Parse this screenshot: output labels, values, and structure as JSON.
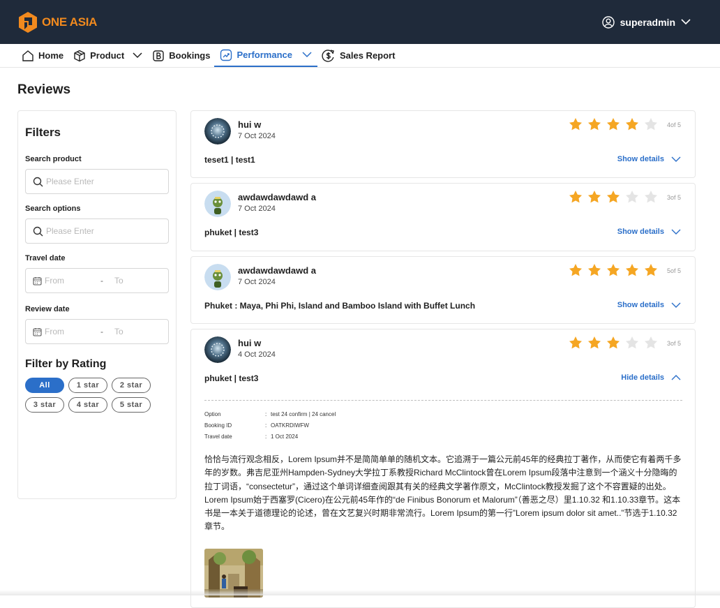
{
  "brand": {
    "name": "ONE ASIA",
    "accent": "#f28a1e",
    "header_bg": "#1f2a3a"
  },
  "user": {
    "name": "superadmin",
    "icon": "user-circle-icon"
  },
  "nav": {
    "home": "Home",
    "product": "Product",
    "bookings": "Bookings",
    "performance": "Performance",
    "sales_report": "Sales Report"
  },
  "page": {
    "title": "Reviews"
  },
  "filters": {
    "heading": "Filters",
    "search_product_label": "Search product",
    "search_product_placeholder": "Please Enter",
    "search_options_label": "Search options",
    "search_options_placeholder": "Please Enter",
    "travel_date_label": "Travel date",
    "review_date_label": "Review date",
    "from": "From",
    "to": "To",
    "dash": "-",
    "rating_heading": "Filter by Rating",
    "chips": [
      "All",
      "1 star",
      "2 star",
      "3 star",
      "4 star",
      "5 star"
    ],
    "active_chip": "All"
  },
  "reviews": [
    {
      "name": "hui  w",
      "date": "7 Oct 2024",
      "rating": 4,
      "score": "4of 5",
      "title": "teset1 | test1",
      "toggle": "Show details",
      "expanded": false
    },
    {
      "name": "awdawdawdawd  a",
      "date": "7 Oct 2024",
      "rating": 3,
      "score": "3of 5",
      "title": "phuket | test3",
      "toggle": "Show details",
      "expanded": false
    },
    {
      "name": "awdawdawdawd  a",
      "date": "7 Oct 2024",
      "rating": 5,
      "score": "5of 5",
      "title": "Phuket : Maya, Phi Phi, Island and Bamboo Island with Buffet Lunch",
      "toggle": "Show details",
      "expanded": false
    },
    {
      "name": "hui  w",
      "date": "4 Oct 2024",
      "rating": 3,
      "score": "3of 5",
      "title": "phuket | test3",
      "toggle": "Hide details",
      "expanded": true,
      "details": [
        {
          "k": "Option",
          "v": "test 24 confirm | 24 cancel"
        },
        {
          "k": "Booking ID",
          "v": "OATKRDIWFW"
        },
        {
          "k": "Travel date",
          "v": "1 Oct 2024"
        }
      ],
      "sep": ":",
      "description": "恰恰与流行观念相反，Lorem Ipsum并不是简简单单的随机文本。它追溯于一篇公元前45年的经典拉丁著作，从而使它有着两千多年的岁数。弗吉尼亚州Hampden-Sydney大学拉丁系教授Richard McClintock曾在Lorem Ipsum段落中注意到一个涵义十分隐晦的拉丁词语，“consectetur”，通过这个单词详细查阅跟其有关的经典文学著作原文，McClintock教授发掘了这个不容置疑的出处。Lorem Ipsum始于西塞罗(Cicero)在公元前45年作的“de Finibus Bonorum et Malorum”（善恶之尽）里1.10.32 和1.10.33章节。这本书是一本关于道德理论的论述，曾在文艺复兴时期非常流行。Lorem Ipsum的第一行”Lorem ipsum dolor sit amet..”节选于1.10.32章节。"
    }
  ],
  "colors": {
    "star_on": "#f5a623",
    "star_off": "#e4e4e4",
    "link": "#2b6fc9"
  }
}
